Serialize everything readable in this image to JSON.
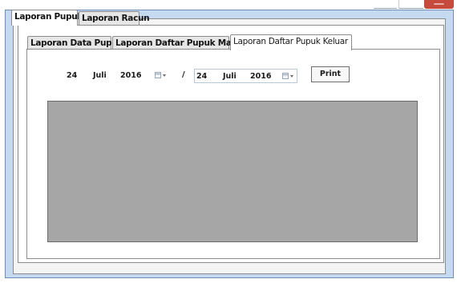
{
  "outer_tabs": [
    {
      "label": "Laporan Pupuk",
      "selected": true
    },
    {
      "label": "Laporan Racun",
      "selected": false
    }
  ],
  "inner_tabs": [
    {
      "label": "Laporan Data Pupuk",
      "selected": false
    },
    {
      "label": "Laporan Daftar Pupuk Masuk",
      "selected": false
    },
    {
      "label": "Laporan Daftar Pupuk Keluar",
      "selected": true
    }
  ],
  "date_from": {
    "day": "24",
    "month": "Juli",
    "year": "2016"
  },
  "date_separator": "/",
  "date_to": {
    "day": "24",
    "month": "Juli",
    "year": "2016"
  },
  "print_button": "Print",
  "icons": {
    "date_dropdown": "calendar-dropdown-icon",
    "window_close": "close-icon"
  },
  "colors": {
    "window_frame": "#c5daf1",
    "report_viewer": "#a6a6a6",
    "close_button": "#c64b3c"
  }
}
